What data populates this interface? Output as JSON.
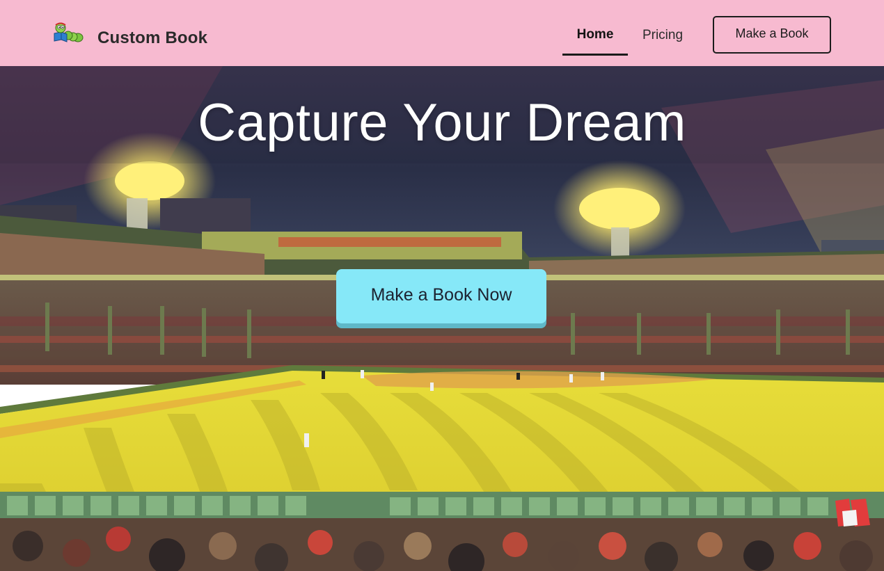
{
  "navbar": {
    "brand_name": "Custom Book",
    "links": [
      {
        "label": "Home",
        "active": true
      },
      {
        "label": "Pricing",
        "active": false
      }
    ],
    "cta_label": "Make a Book"
  },
  "hero": {
    "title": "Capture Your Dream",
    "cta_label": "Make a Book Now",
    "background": "baseball-stadium-night-illustration"
  },
  "colors": {
    "navbar_bg": "#f7bad0",
    "hero_cta_bg": "#86e8f8",
    "field_yellow": "#e8d93a",
    "sky": "#2a2f45"
  }
}
